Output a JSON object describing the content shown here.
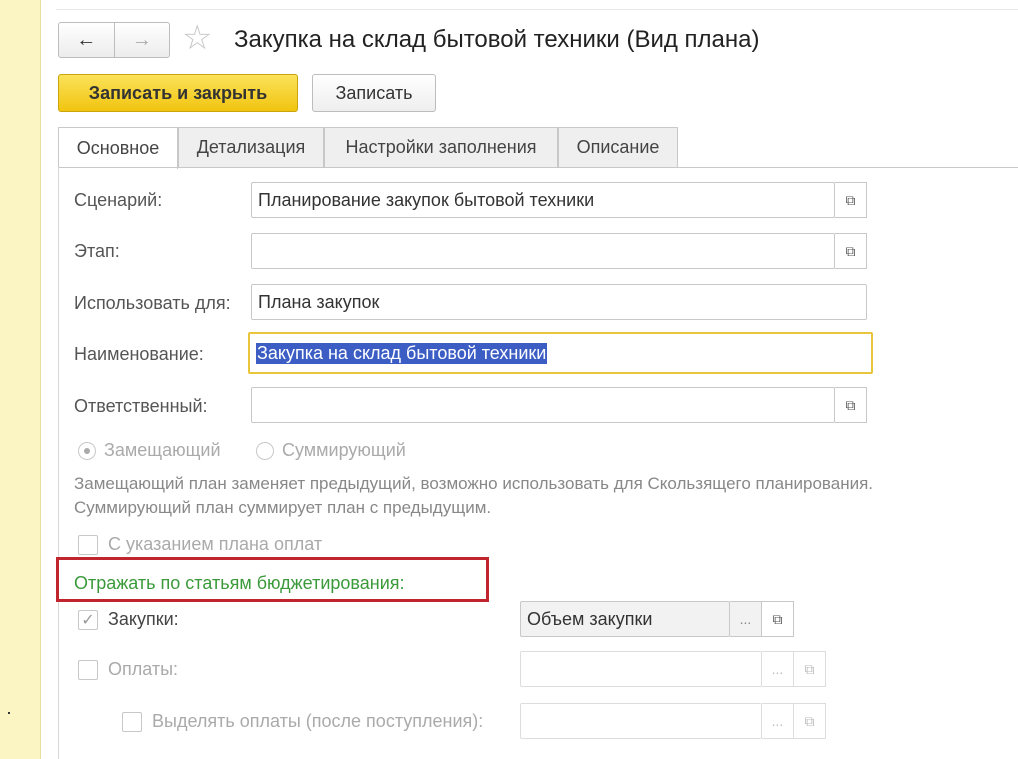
{
  "window": {
    "title": "Закупка на склад бытовой техники (Вид плана)",
    "nav_back": "←",
    "nav_forward": "→",
    "favorite_icon": "☆"
  },
  "toolbar": {
    "save_close_label": "Записать и закрыть",
    "save_label": "Записать"
  },
  "tabs": [
    {
      "label": "Основное",
      "active": true
    },
    {
      "label": "Детализация",
      "active": false
    },
    {
      "label": "Настройки заполнения",
      "active": false
    },
    {
      "label": "Описание",
      "active": false
    }
  ],
  "form": {
    "scenario": {
      "label": "Сценарий:",
      "value": "Планирование закупок бытовой техники"
    },
    "stage": {
      "label": "Этап:",
      "value": ""
    },
    "use_for": {
      "label": "Использовать для:",
      "value": "Плана закупок"
    },
    "name": {
      "label": "Наименование:",
      "value": "Закупка на склад бытовой техники"
    },
    "responsible": {
      "label": "Ответственный:",
      "value": ""
    },
    "radio_replace": "Замещающий",
    "radio_sum": "Суммирующий",
    "note_line1": "Замещающий план заменяет предыдущий, возможно использовать для Скользящего планирования.",
    "note_line2": "Суммирующий план суммирует план с предыдущим.",
    "payment_plan_label": "С указанием плана оплат",
    "section_title": "Отражать по статьям бюджетирования:",
    "purchases": {
      "label": "Закупки:",
      "value": "Объем закупки",
      "checked": true
    },
    "payments": {
      "label": "Оплаты:",
      "value": "",
      "checked": false
    },
    "separate_payments": {
      "label": "Выделять оплаты (после поступления):",
      "value": "",
      "checked": false
    },
    "ellipsis": "...",
    "open_icon": "⧉",
    "check_mark": "✓"
  }
}
